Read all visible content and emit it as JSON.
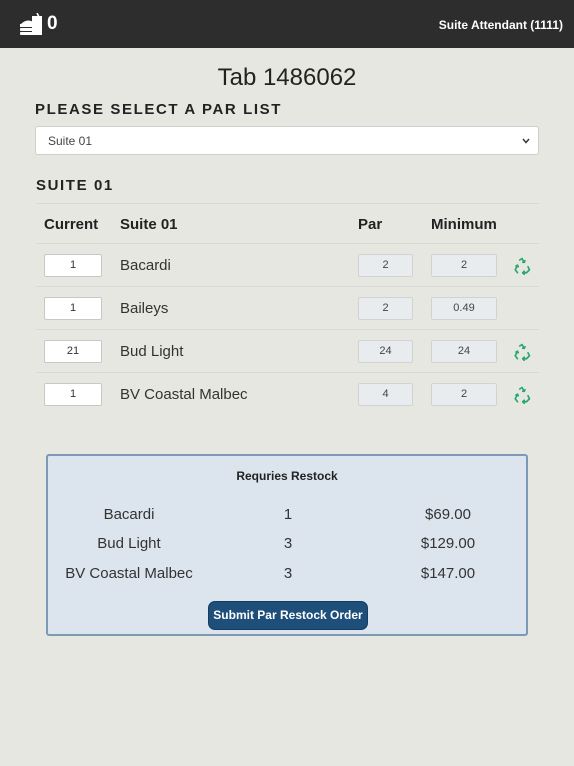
{
  "header": {
    "cart_count": "0",
    "user_label": "Suite Attendant (1111)"
  },
  "page": {
    "tab_title": "Tab 1486062",
    "par_list_heading": "PLEASE SELECT A PAR LIST",
    "par_list_selected": "Suite 01",
    "suite_heading": "SUITE 01"
  },
  "table": {
    "columns": [
      "Current",
      "Suite 01",
      "Par",
      "Minimum"
    ],
    "rows": [
      {
        "current": "1",
        "name": "Bacardi",
        "par": "2",
        "minimum": "2",
        "needs_restock": true
      },
      {
        "current": "1",
        "name": "Baileys",
        "par": "2",
        "minimum": "0.49",
        "needs_restock": false
      },
      {
        "current": "21",
        "name": "Bud Light",
        "par": "24",
        "minimum": "24",
        "needs_restock": true
      },
      {
        "current": "1",
        "name": "BV Coastal Malbec",
        "par": "4",
        "minimum": "2",
        "needs_restock": true
      }
    ]
  },
  "restock": {
    "title": "Requries Restock",
    "items": [
      {
        "name": "Bacardi",
        "qty": "1",
        "price": "$69.00"
      },
      {
        "name": "Bud Light",
        "qty": "3",
        "price": "$129.00"
      },
      {
        "name": "BV Coastal Malbec",
        "qty": "3",
        "price": "$147.00"
      }
    ],
    "submit_label": "Submit Par Restock Order"
  },
  "colors": {
    "topbar": "#2d2d2d",
    "background": "#e7e7e1",
    "restock_panel": "#dce5ee",
    "submit_button": "#1e4f7b",
    "recycle_icon": "#27a86b"
  },
  "icons": {
    "cart": "food-cart-icon",
    "select": "chevron-down-icon",
    "restock_flag": "recycle-icon"
  }
}
